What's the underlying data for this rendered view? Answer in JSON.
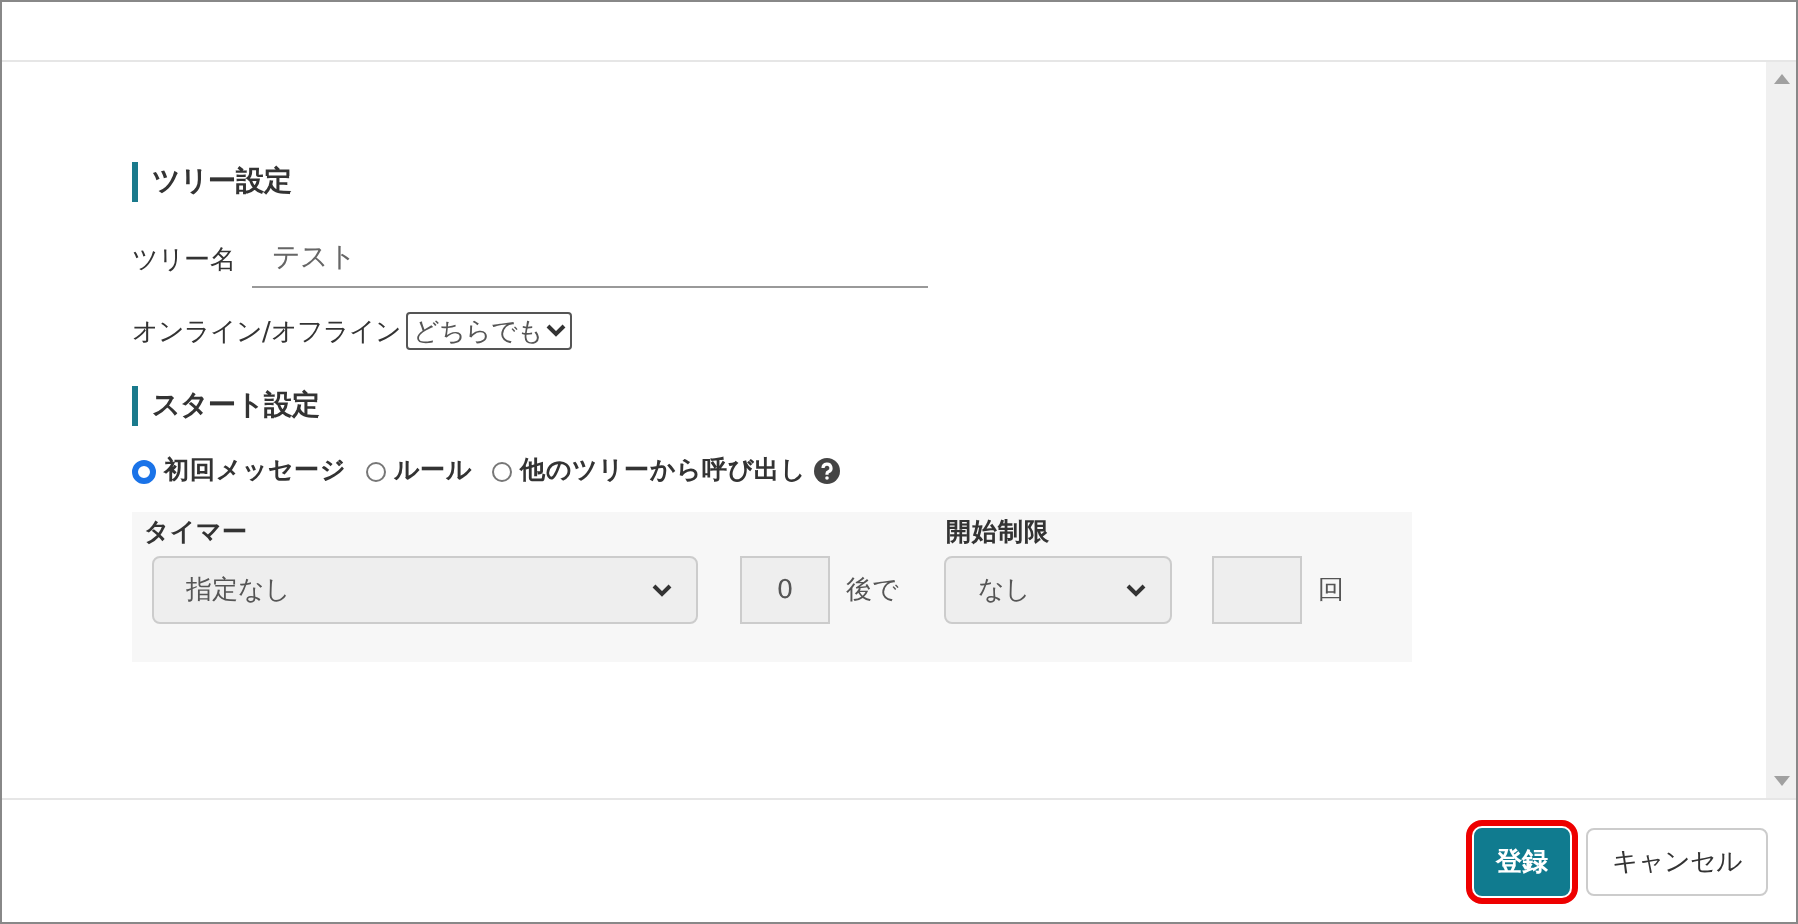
{
  "tree_settings": {
    "heading": "ツリー設定",
    "name_label": "ツリー名",
    "name_value": "テスト",
    "online_label": "オンライン/オフライン",
    "online_select": "どちらでも"
  },
  "start_settings": {
    "heading": "スタート設定",
    "options": [
      {
        "label": "初回メッセージ",
        "selected": true
      },
      {
        "label": "ルール",
        "selected": false
      },
      {
        "label": "他のツリーから呼び出し",
        "selected": false
      }
    ],
    "timer_label": "タイマー",
    "timer_select": "指定なし",
    "timer_value": "0",
    "timer_suffix": "後で",
    "limit_label": "開始制限",
    "limit_select": "なし",
    "limit_suffix": "回"
  },
  "buttons": [
    {
      "label": "登録",
      "kind": "primary",
      "highlighted": true
    },
    {
      "label": "キャンセル",
      "kind": "secondary",
      "highlighted": false
    }
  ]
}
